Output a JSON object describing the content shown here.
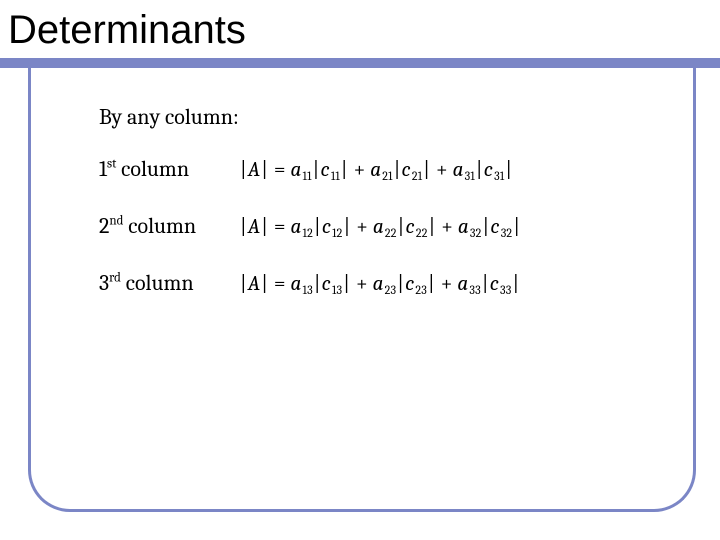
{
  "title": "Determinants",
  "subheading": "By any column:",
  "rows": [
    {
      "label_num": "1",
      "label_ord": "st",
      "label_word": " column",
      "formula_html": "<span class='abs'>|</span>A<span class='abs'>|</span> <span class='up'>=</span> a<sub>11</sub><span class='abs'>|</span>c<sub>11</sub><span class='abs'>|</span> <span class='up'>+</span> a<sub>21</sub><span class='abs'>|</span>c<sub>21</sub><span class='abs'>|</span> <span class='up'>+</span> a<sub>31</sub><span class='abs'>|</span>c<sub>31</sub><span class='abs'>|</span>"
    },
    {
      "label_num": "2",
      "label_ord": "nd",
      "label_word": " column",
      "formula_html": "<span class='abs'>|</span>A<span class='abs'>|</span> <span class='up'>=</span> a<sub>12</sub><span class='abs'>|</span>c<sub>12</sub><span class='abs'>|</span> <span class='up'>+</span> a<sub>22</sub><span class='abs'>|</span>c<sub>22</sub><span class='abs'>|</span> <span class='up'>+</span> a<sub>32</sub><span class='abs'>|</span>c<sub>32</sub><span class='abs'>|</span>"
    },
    {
      "label_num": "3",
      "label_ord": "rd",
      "label_word": " column",
      "formula_html": "<span class='abs'>|</span>A<span class='abs'>|</span> <span class='up'>=</span> a<sub>13</sub><span class='abs'>|</span>c<sub>13</sub><span class='abs'>|</span> <span class='up'>+</span> a<sub>23</sub><span class='abs'>|</span>c<sub>23</sub><span class='abs'>|</span> <span class='up'>+</span> a<sub>33</sub><span class='abs'>|</span>c<sub>33</sub><span class='abs'>|</span>"
    }
  ],
  "colors": {
    "accent": "#7b86c6"
  }
}
